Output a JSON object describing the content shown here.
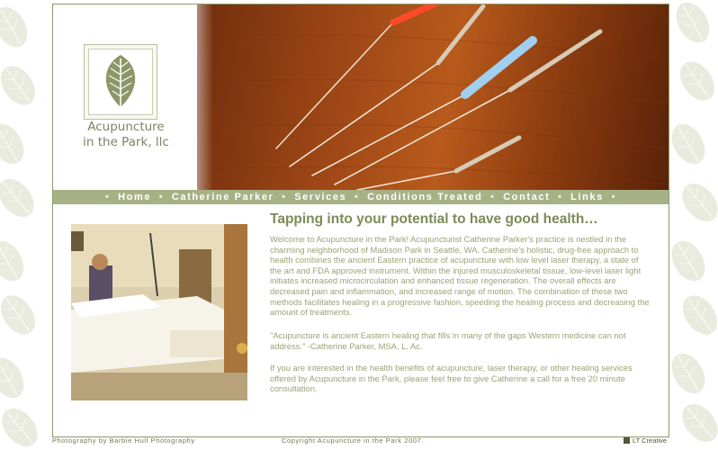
{
  "logo": {
    "line1": "Acupuncture",
    "line2": "in the Park, llc",
    "icon": "leaf-icon"
  },
  "nav": {
    "items": [
      "Home",
      "Catherine Parker",
      "Services",
      "Conditions Treated",
      "Contact",
      "Links"
    ],
    "separator": "•"
  },
  "main": {
    "heading": "Tapping into your potential to have good health…",
    "paragraph1": "Welcome to Acupuncture in the Park! Acupuncturist Catherine Parker's practice is nestled in the charming neighborhood of Madison Park in Seattle, WA. Catherine's holistic, drug-free approach to health combines the ancient Eastern practice of acupuncture with low level laser therapy, a state of the art and FDA approved instrument. Within the injured musculoskeletal tissue, low-level laser light initiates increased microcirculation and enhanced tissue regeneration. The overall effects are decreased pain and inflammation, and increased range of motion. The combination of these two methods facilitates healing in a progressive fashion, speeding the healing process and decreasing the amount of treatments.",
    "paragraph2": "\"Acupuncture is ancient Eastern healing that fills in many of the gaps Western medicine can not address.\" -Catherine Parker, MSA, L. Ac.",
    "paragraph3": "If you are interested in the health benefits of acupuncture, laser therapy, or other healing services offered by Acupuncture in the Park, please feel free to give Catherine a call for a free 20 minute consultation."
  },
  "footer": {
    "photo_credit": "Photography by Barbie Hull Photography",
    "copyright": "Copyright Acupuncture in the Park 2007.",
    "designer": "LT Creative"
  },
  "colors": {
    "accent": "#a7b186",
    "heading": "#7e8a57",
    "body_text": "#9aa474"
  }
}
